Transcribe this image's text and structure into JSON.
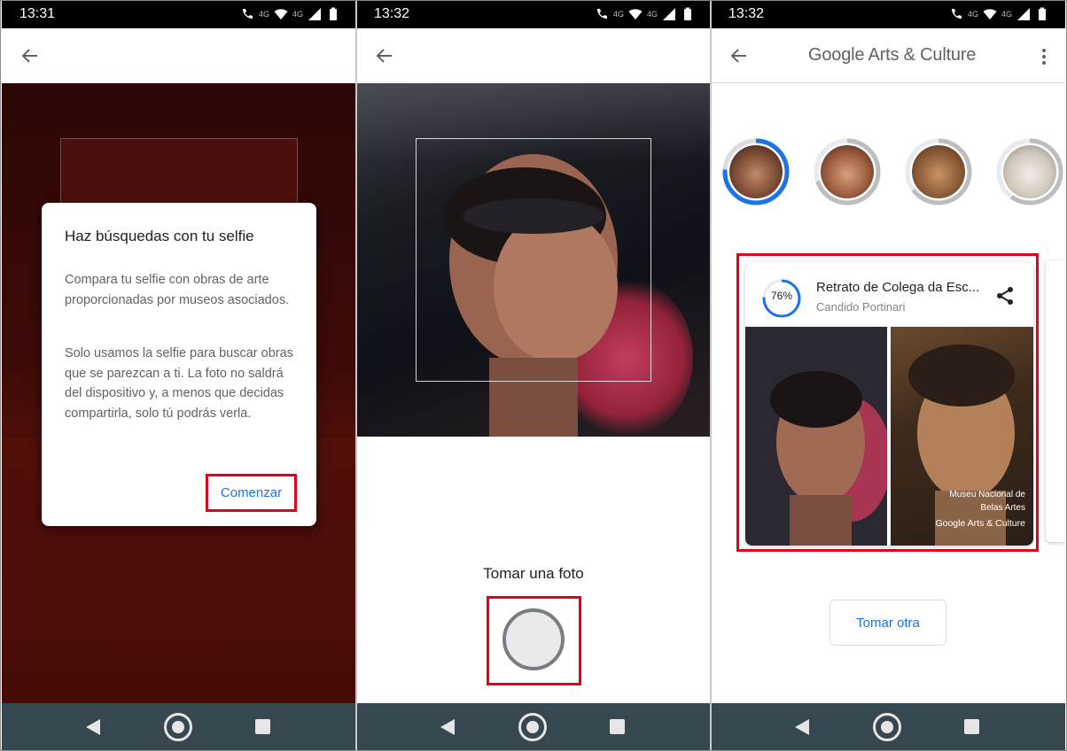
{
  "panels": [
    {
      "status_time": "13:31",
      "dialog": {
        "title": "Haz búsquedas con tu selfie",
        "paragraph_1": "Compara tu selfie con obras de arte proporcionadas por museos asociados.",
        "paragraph_2": "Solo usamos la selfie para buscar obras que se parezcan a ti. La foto no saldrá del dispositivo y, a menos que decidas compartirla, solo tú podrás verla.",
        "action_label": "Comenzar"
      }
    },
    {
      "status_time": "13:32",
      "take_photo_label": "Tomar una foto"
    },
    {
      "status_time": "13:32",
      "app_title": "Google Arts & Culture",
      "avatars": [
        {
          "name": "avatar-match-1",
          "selected": true,
          "progress": 0.76
        },
        {
          "name": "avatar-match-2",
          "selected": false,
          "progress": 0.7
        },
        {
          "name": "avatar-match-3",
          "selected": false,
          "progress": 0.65
        },
        {
          "name": "avatar-match-4",
          "selected": false,
          "progress": 0.6
        }
      ],
      "result": {
        "percent_label": "76%",
        "percent": 0.76,
        "title": "Retrato de Colega da Esc...",
        "artist": "Candido Portinari",
        "museum_line_1": "Museu Nacional de",
        "museum_line_2": "Belas Artes",
        "brand": "Google Arts & Culture"
      },
      "retake_label": "Tomar otra"
    }
  ],
  "status_icons": [
    "call-icon",
    "wifi-icon",
    "signal-icon",
    "battery-icon"
  ],
  "status_network": "4G",
  "nav_icons": [
    "nav-back-icon",
    "nav-home-icon",
    "nav-recents-icon"
  ],
  "colors": {
    "accent": "#1a73e8",
    "highlight_box": "#e3001b",
    "nav_bar": "#37474f",
    "status_bar": "#000000"
  }
}
